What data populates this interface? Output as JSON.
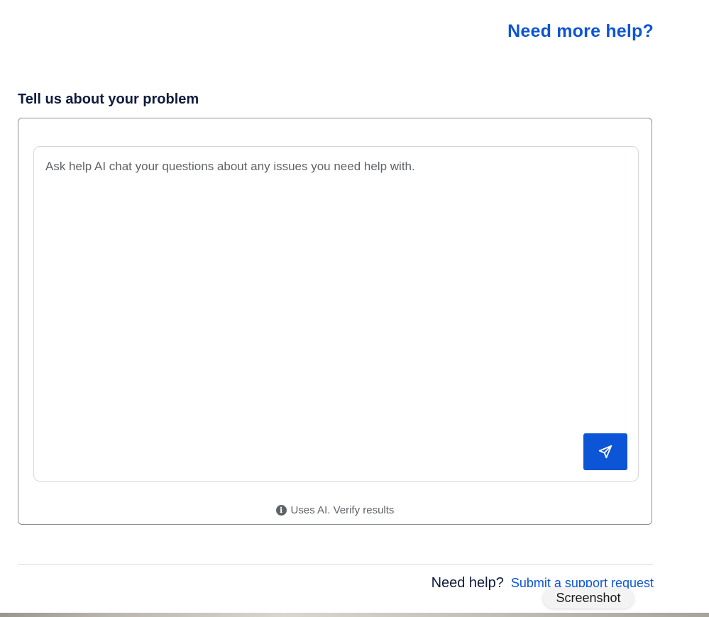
{
  "header": {
    "need_more_help": "Need more help?"
  },
  "problem_section": {
    "title": "Tell us about your problem",
    "chat_placeholder": "Ask help AI chat your questions about any issues you need help with.",
    "send_icon": "send-icon",
    "ai_note": "Uses AI. Verify results",
    "info_icon": "info-icon"
  },
  "footer": {
    "need_help_label": "Need help?",
    "submit_link": "Submit a support request"
  },
  "tooltip": {
    "label": "Screenshot"
  },
  "colors": {
    "accent": "#0c55d6",
    "heading": "#0f1b3d",
    "muted": "#5f6368",
    "border": "#8c8f95"
  }
}
